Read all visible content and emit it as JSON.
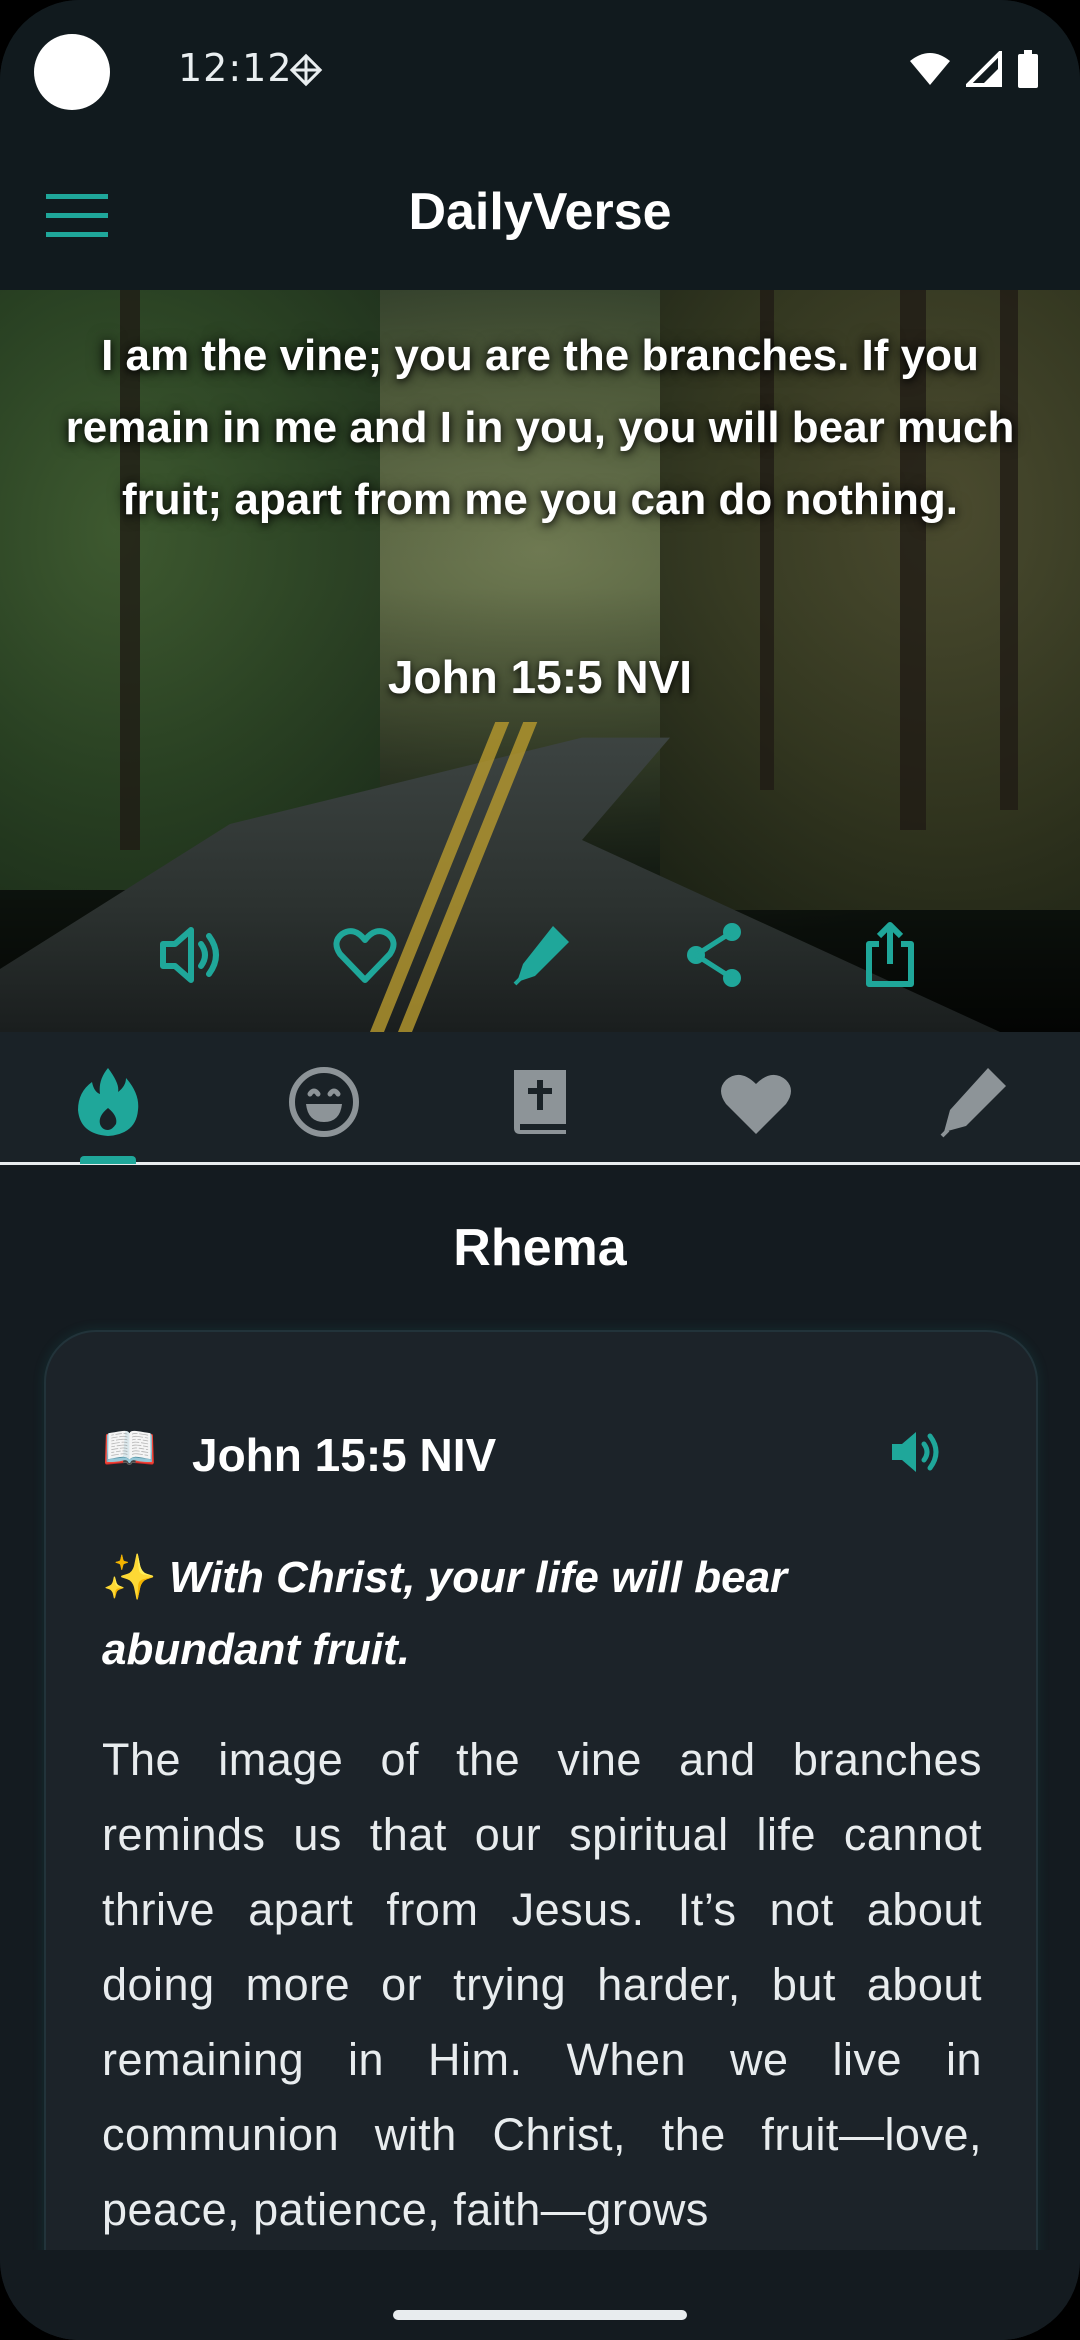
{
  "status_bar": {
    "time": "12:12"
  },
  "app_bar": {
    "title": "DailyVerse"
  },
  "hero": {
    "verse_text": "I am the vine; you are the branches. If you remain in me and I in you, you will bear much fruit; apart from me you can do nothing.",
    "reference": "John 15:5 NVI",
    "actions": [
      {
        "icon": "speaker-icon"
      },
      {
        "icon": "heart-outline-icon"
      },
      {
        "icon": "pen-icon"
      },
      {
        "icon": "share-icon"
      },
      {
        "icon": "export-icon"
      }
    ]
  },
  "tabs": [
    {
      "icon": "flame-icon",
      "selected": true
    },
    {
      "icon": "smiley-icon",
      "selected": false
    },
    {
      "icon": "bible-icon",
      "selected": false
    },
    {
      "icon": "heart-icon",
      "selected": false
    },
    {
      "icon": "pen-icon",
      "selected": false
    }
  ],
  "section": {
    "title": "Rhema"
  },
  "card": {
    "book_emoji": "📖",
    "reference": "John 15:5 NIV",
    "sparkle": "✨",
    "highlight": "With Christ, your life will bear abundant fruit.",
    "body": "The image of the vine and branches reminds us that our spiritual life cannot thrive apart from Jesus. It’s not about doing more or trying harder, but about remaining in Him. When we live in communion with Christ, the fruit—love, peace, patience, faith—grows"
  },
  "colors": {
    "accent": "#1fa79a",
    "background": "#141b20",
    "card": "#1c2329",
    "icon_muted": "#8d9498"
  }
}
